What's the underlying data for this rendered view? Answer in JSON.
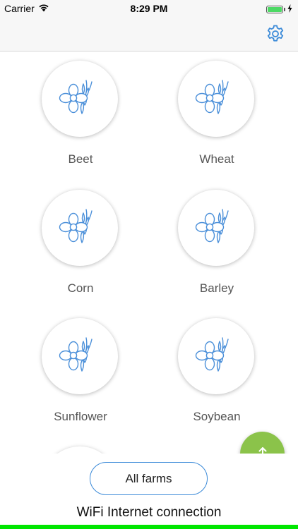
{
  "status_bar": {
    "carrier": "Carrier",
    "time": "8:29 PM",
    "battery_level": 1.0,
    "icons": [
      "wifi-icon",
      "battery-icon",
      "charging-icon"
    ]
  },
  "nav": {
    "settings_icon": "gear-icon"
  },
  "crops": [
    {
      "label": "Beet"
    },
    {
      "label": "Wheat"
    },
    {
      "label": "Corn"
    },
    {
      "label": "Barley"
    },
    {
      "label": "Sunflower"
    },
    {
      "label": "Soybean"
    }
  ],
  "crop_icon": "flower-plant-icon",
  "fab": {
    "icon": "upload-icon"
  },
  "bottom": {
    "all_farms_label": "All farms",
    "connection_status": "WiFi Internet connection"
  },
  "colors": {
    "accent_blue": "#3b8ad8",
    "fab_green": "#8bc34a",
    "connection_green": "#00e600",
    "battery_green": "#4cd964"
  }
}
